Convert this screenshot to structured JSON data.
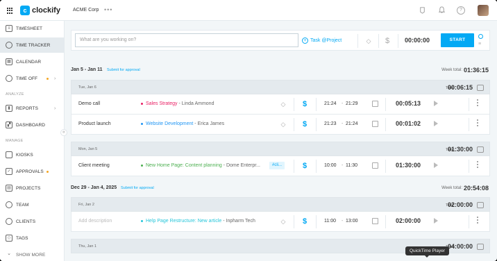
{
  "app": {
    "name": "clockify",
    "workspace": "ACME Corp"
  },
  "colors": {
    "accent": "#03a9f4",
    "sales_strategy": "#e91e63",
    "website_development": "#2196f3",
    "new_home_page": "#4caf50",
    "help_page": "#26c6da"
  },
  "sidebar": {
    "items": [
      {
        "label": "TIMESHEET",
        "icon": "timesheet-icon"
      },
      {
        "label": "TIME TRACKER",
        "icon": "clock-icon"
      },
      {
        "label": "CALENDAR",
        "icon": "calendar-icon"
      },
      {
        "label": "TIME OFF",
        "icon": "time-off-icon"
      },
      {
        "label": "REPORTS",
        "icon": "reports-icon"
      },
      {
        "label": "DASHBOARD",
        "icon": "dashboard-icon"
      },
      {
        "label": "KIOSKS",
        "icon": "kiosk-icon"
      },
      {
        "label": "APPROVALS",
        "icon": "approvals-icon"
      },
      {
        "label": "PROJECTS",
        "icon": "projects-icon"
      },
      {
        "label": "TEAM",
        "icon": "team-icon"
      },
      {
        "label": "CLIENTS",
        "icon": "clients-icon"
      },
      {
        "label": "TAGS",
        "icon": "tag-icon"
      },
      {
        "label": "SHOW MORE",
        "icon": "chevron-down-icon"
      }
    ],
    "section_analyze": "ANALYZE",
    "section_manage": "MANAGE"
  },
  "timer": {
    "placeholder": "What are you working on?",
    "project_label": "Task @Project",
    "time": "00:00:00",
    "start_label": "START"
  },
  "weeks": [
    {
      "range": "Jan 5 - Jan 11",
      "approval": "Submit for approval",
      "total_label": "Week total:",
      "total": "01:36:15",
      "days": [
        {
          "label": "Tue, Jan 6",
          "total_label": "Total:",
          "total": "00:06:15",
          "entries": [
            {
              "description": "Demo call",
              "project": "Sales Strategy",
              "client": "Linda Ammond",
              "start": "21:24",
              "end": "21:29",
              "duration": "00:05:13"
            },
            {
              "description": "Product launch",
              "project": "Website Development",
              "client": "Erica James",
              "start": "21:23",
              "end": "21:24",
              "duration": "00:01:02"
            }
          ]
        },
        {
          "label": "Mon, Jan 5",
          "total_label": "Total:",
          "total": "01:30:00",
          "entries": [
            {
              "description": "Client meeting",
              "project": "New Home Page: Content planning",
              "client": "Dome Enterpr...",
              "tag": "#cli...",
              "start": "10:00",
              "end": "11:30",
              "duration": "01:30:00"
            }
          ]
        }
      ]
    },
    {
      "range": "Dec 29 - Jan 4, 2025",
      "approval": "Submit for approval",
      "total_label": "Week total:",
      "total": "20:54:08",
      "days": [
        {
          "label": "Fri, Jan 2",
          "total_label": "Total:",
          "total": "02:00:00",
          "entries": [
            {
              "description": "Add description",
              "project": "Help Page Restructure: New article",
              "client": "Inpharm Tech",
              "start": "11:00",
              "end": "13:00",
              "duration": "02:00:00"
            }
          ]
        },
        {
          "label": "Thu, Jan 1",
          "total_label": "Total:",
          "total": "04:00:00",
          "entries": []
        }
      ]
    }
  ],
  "tooltip": "QuickTime Player"
}
